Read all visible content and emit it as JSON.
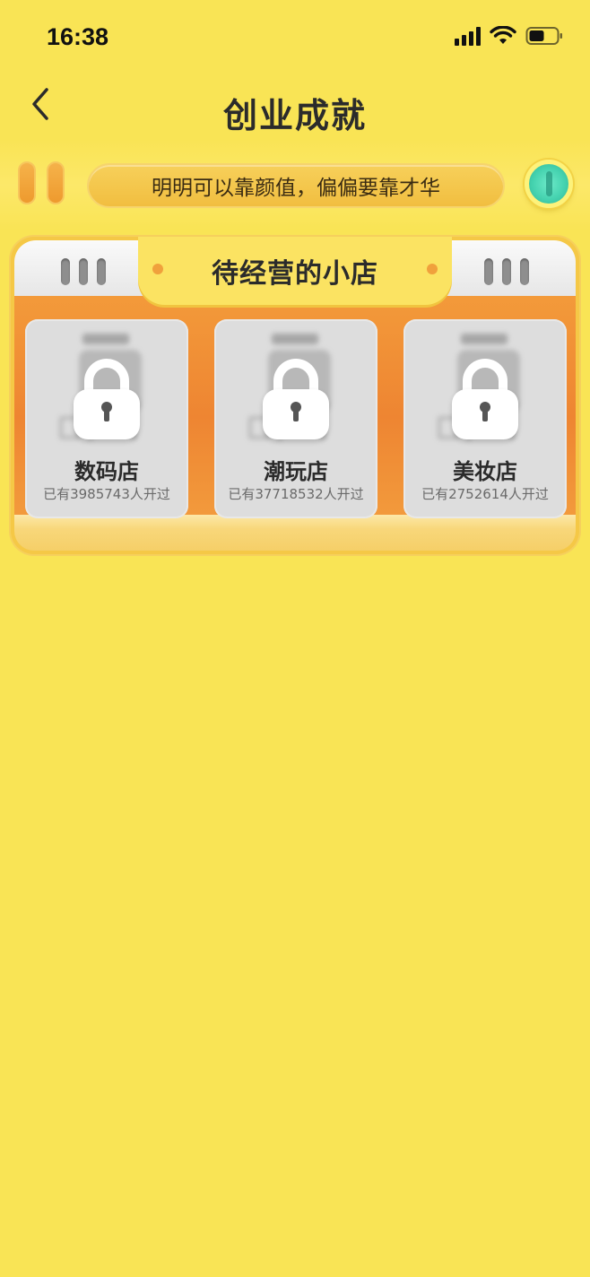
{
  "status_bar": {
    "time": "16:38",
    "icons": [
      "signal-icon",
      "wifi-icon",
      "battery-icon"
    ]
  },
  "nav": {
    "back_icon": "chevron-left-icon",
    "title": "创业成就"
  },
  "top_bar": {
    "slogan": "明明可以靠颜值，偏偏要靠才华",
    "left_icon": "pause-icon",
    "right_icon": "coin-icon"
  },
  "panel": {
    "title": "待经营的小店",
    "shops": [
      {
        "name": "数码店",
        "count": "已有3985743人开过",
        "icon": "lock-icon"
      },
      {
        "name": "潮玩店",
        "count": "已有37718532人开过",
        "icon": "lock-icon"
      },
      {
        "name": "美妆店",
        "count": "已有2752614人开过",
        "icon": "lock-icon"
      }
    ]
  },
  "colors": {
    "background": "#F9E455",
    "panel_orange": "#EE8532",
    "card_gray": "#DDDDDD",
    "coin_teal": "#46D3B0"
  }
}
